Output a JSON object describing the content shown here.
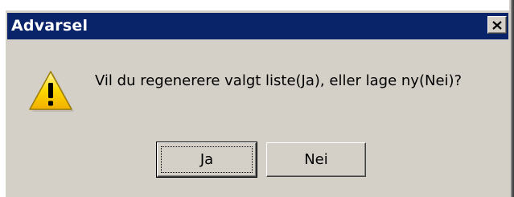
{
  "window": {
    "title": "Advarsel",
    "close_icon": "close-icon",
    "colors": {
      "titlebar": "#0a246a",
      "face": "#d4d0c8",
      "title_text": "#ffffff"
    }
  },
  "dialog": {
    "icon": "warning-icon",
    "message": "Vil du regenerere valgt liste(Ja), eller lage ny(Nei)?",
    "buttons": {
      "yes_label": "Ja",
      "no_label": "Nei"
    }
  }
}
